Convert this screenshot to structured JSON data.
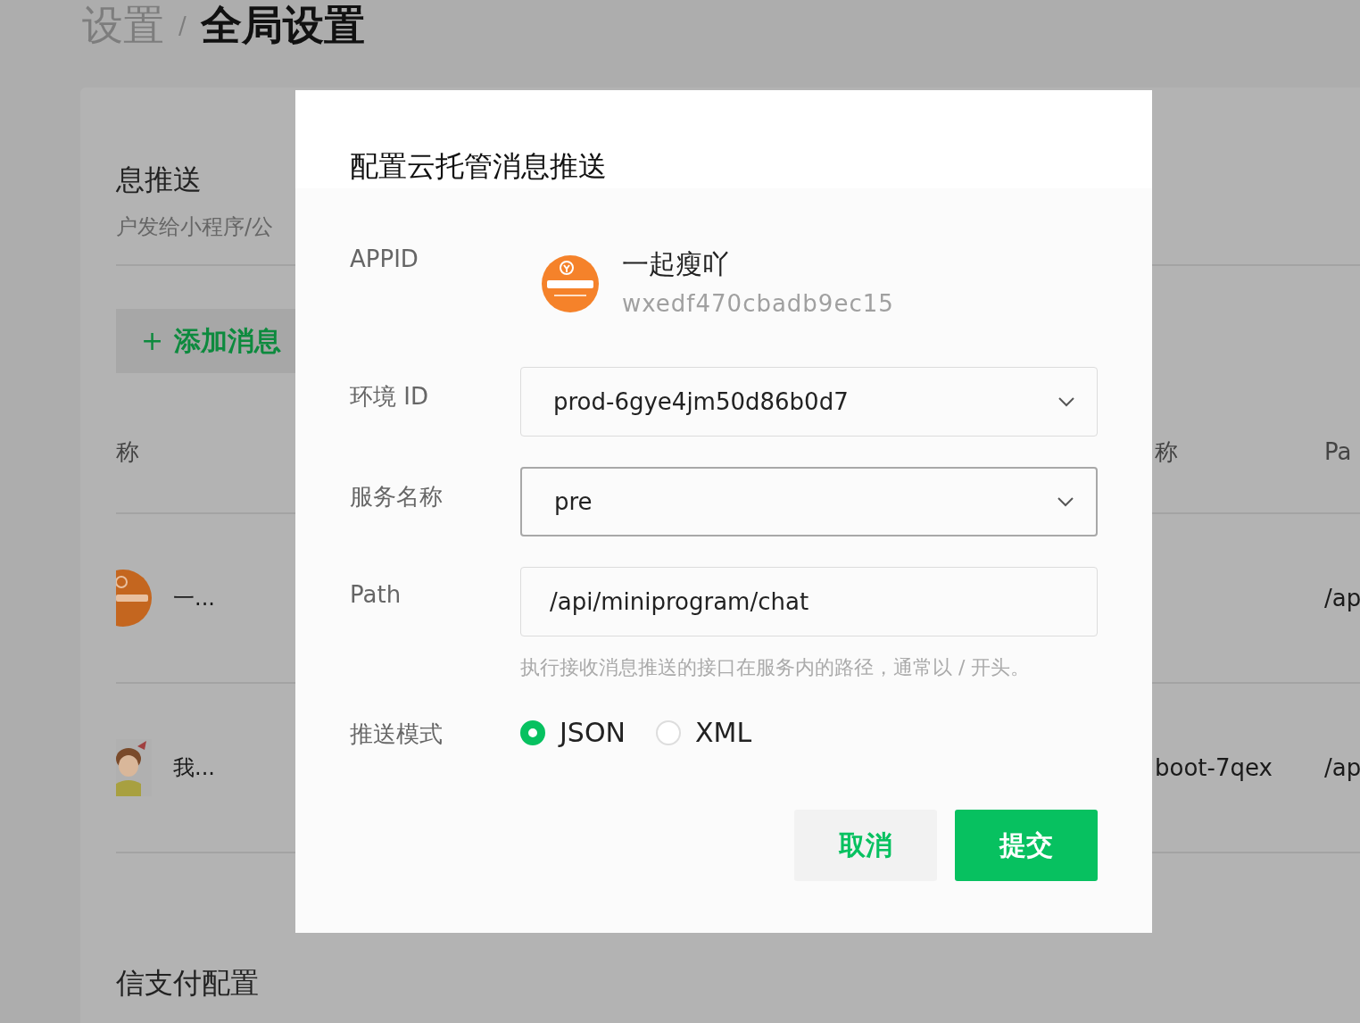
{
  "breadcrumb": {
    "parent": "设置",
    "separator": "/",
    "current": "全局设置"
  },
  "section": {
    "title": "息推送",
    "description": "户发给小程序/公",
    "add_button": {
      "icon": "+",
      "label": "添加消息"
    }
  },
  "table": {
    "columns_left": [
      "称"
    ],
    "columns_right": [
      "称",
      "Pa"
    ],
    "rows": [
      {
        "avatar": {
          "kind": "logo"
        },
        "name": "一...",
        "column_right_1": "",
        "path": "/ap"
      },
      {
        "name": "我...",
        "column_right_1": "boot-7qex",
        "path": "/ap"
      }
    ]
  },
  "next_section": {
    "title": "信支付配置"
  },
  "dialog": {
    "title": "配置云托管消息推送",
    "fields": [
      {
        "kind": "app",
        "label": "APPID",
        "name": "一起瘦吖",
        "appid": "wxedf470cbadb9ec15"
      },
      {
        "kind": "select",
        "label": "环境 ID",
        "value": "prod-6gye4jm50d86b0d7",
        "focused": false
      },
      {
        "kind": "select",
        "label": "服务名称",
        "value": "pre",
        "focused": true
      },
      {
        "kind": "input",
        "label": "Path",
        "value": "/api/miniprogram/chat",
        "hint": "执行接收消息推送的接口在服务内的路径，通常以 / 开头。"
      },
      {
        "kind": "radio",
        "label": "推送模式",
        "options": [
          {
            "label": "JSON",
            "selected": true
          },
          {
            "label": "XML",
            "selected": false
          }
        ]
      }
    ],
    "buttons": [
      {
        "kind": "secondary",
        "label": "取消"
      },
      {
        "kind": "primary",
        "label": "提交"
      }
    ]
  }
}
